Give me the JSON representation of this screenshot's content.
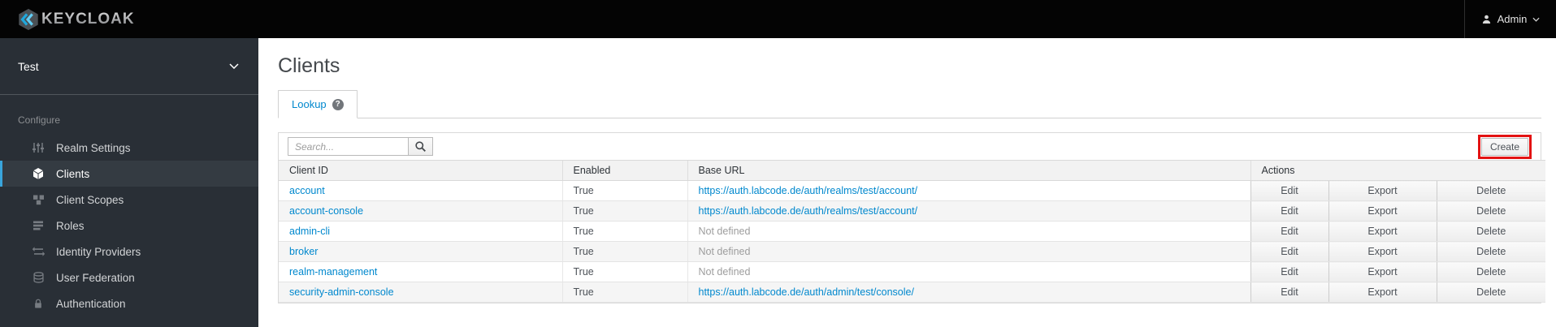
{
  "topbar": {
    "brand": "KEYCLOAK",
    "user_label": "Admin"
  },
  "sidebar": {
    "realm_name": "Test",
    "section_label": "Configure",
    "items": [
      {
        "label": "Realm Settings",
        "icon": "sliders-icon",
        "active": false
      },
      {
        "label": "Clients",
        "icon": "cube-icon",
        "active": true
      },
      {
        "label": "Client Scopes",
        "icon": "cubes-icon",
        "active": false
      },
      {
        "label": "Roles",
        "icon": "list-icon",
        "active": false
      },
      {
        "label": "Identity Providers",
        "icon": "exchange-icon",
        "active": false
      },
      {
        "label": "User Federation",
        "icon": "database-icon",
        "active": false
      },
      {
        "label": "Authentication",
        "icon": "lock-icon",
        "active": false
      }
    ]
  },
  "main": {
    "title": "Clients",
    "tab": {
      "label": "Lookup",
      "active": true,
      "help_glyph": "?"
    },
    "toolbar": {
      "search_placeholder": "Search...",
      "create_label": "Create"
    },
    "table": {
      "columns": [
        "Client ID",
        "Enabled",
        "Base URL",
        "Actions"
      ],
      "action_labels": [
        "Edit",
        "Export",
        "Delete"
      ],
      "rows": [
        {
          "client_id": "account",
          "enabled": "True",
          "base_url": "https://auth.labcode.de/auth/realms/test/account/",
          "url_defined": true
        },
        {
          "client_id": "account-console",
          "enabled": "True",
          "base_url": "https://auth.labcode.de/auth/realms/test/account/",
          "url_defined": true
        },
        {
          "client_id": "admin-cli",
          "enabled": "True",
          "base_url": "Not defined",
          "url_defined": false
        },
        {
          "client_id": "broker",
          "enabled": "True",
          "base_url": "Not defined",
          "url_defined": false
        },
        {
          "client_id": "realm-management",
          "enabled": "True",
          "base_url": "Not defined",
          "url_defined": false
        },
        {
          "client_id": "security-admin-console",
          "enabled": "True",
          "base_url": "https://auth.labcode.de/auth/admin/test/console/",
          "url_defined": true
        }
      ]
    }
  },
  "colors": {
    "link_blue": "#0088ce",
    "nav_active_indicator": "#39a5dc",
    "annotation_red": "#e31212",
    "topbar_black": "#040404",
    "sidebar_dark": "#292f36"
  }
}
